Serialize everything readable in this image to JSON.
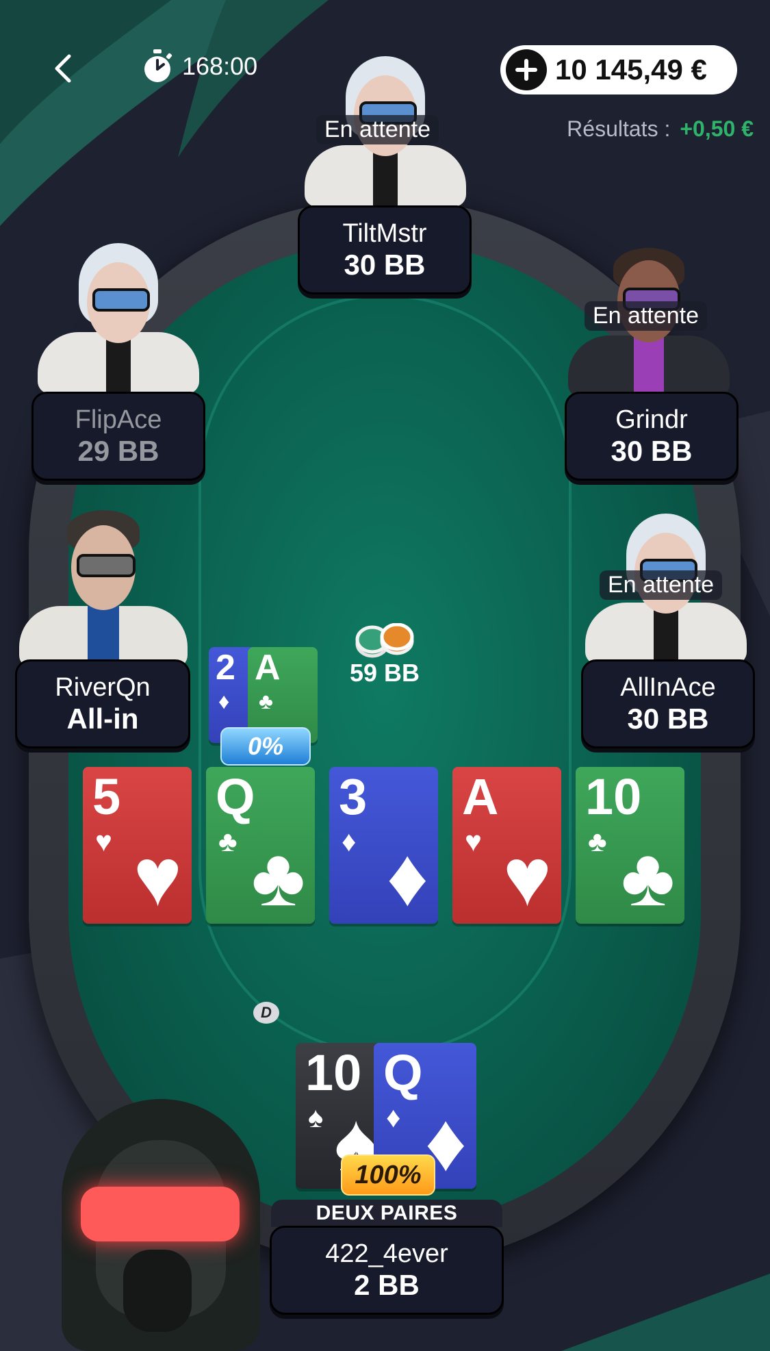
{
  "topbar": {
    "timer": "168:00",
    "balance": "10 145,49 €"
  },
  "results": {
    "label": "Résultats :",
    "value": "+0,50 €"
  },
  "status_waiting": "En attente",
  "players": {
    "top": {
      "name": "TiltMstr",
      "stack": "30 BB",
      "status": "En attente"
    },
    "left_upper": {
      "name": "FlipAce",
      "stack": "29 BB"
    },
    "right_upper": {
      "name": "Grindr",
      "stack": "30 BB",
      "status": "En attente"
    },
    "left_lower": {
      "name": "RiverQn",
      "stack": "All-in",
      "hand_cards": [
        {
          "rank": "2",
          "suit": "♦"
        },
        {
          "rank": "A",
          "suit": "♣"
        }
      ],
      "equity": "0%"
    },
    "right_lower": {
      "name": "AllInAce",
      "stack": "30 BB",
      "status": "En attente"
    },
    "hero": {
      "name": "422_4ever",
      "stack": "2 BB",
      "hand_label": "DEUX PAIRES",
      "equity": "100%",
      "hand_cards": [
        {
          "rank": "10",
          "suit": "♠",
          "color": "black"
        },
        {
          "rank": "Q",
          "suit": "♦",
          "color": "blue"
        }
      ]
    }
  },
  "pot": "59 BB",
  "dealer_button": "D",
  "board": [
    {
      "rank": "5",
      "suit": "♥",
      "color": "red"
    },
    {
      "rank": "Q",
      "suit": "♣",
      "color": "green"
    },
    {
      "rank": "3",
      "suit": "♦",
      "color": "blue"
    },
    {
      "rank": "A",
      "suit": "♥",
      "color": "red"
    },
    {
      "rank": "10",
      "suit": "♣",
      "color": "green"
    }
  ],
  "colors": {
    "felt": "#0a5e4d",
    "profit": "#2fb36a",
    "plate": "#171a2a"
  }
}
